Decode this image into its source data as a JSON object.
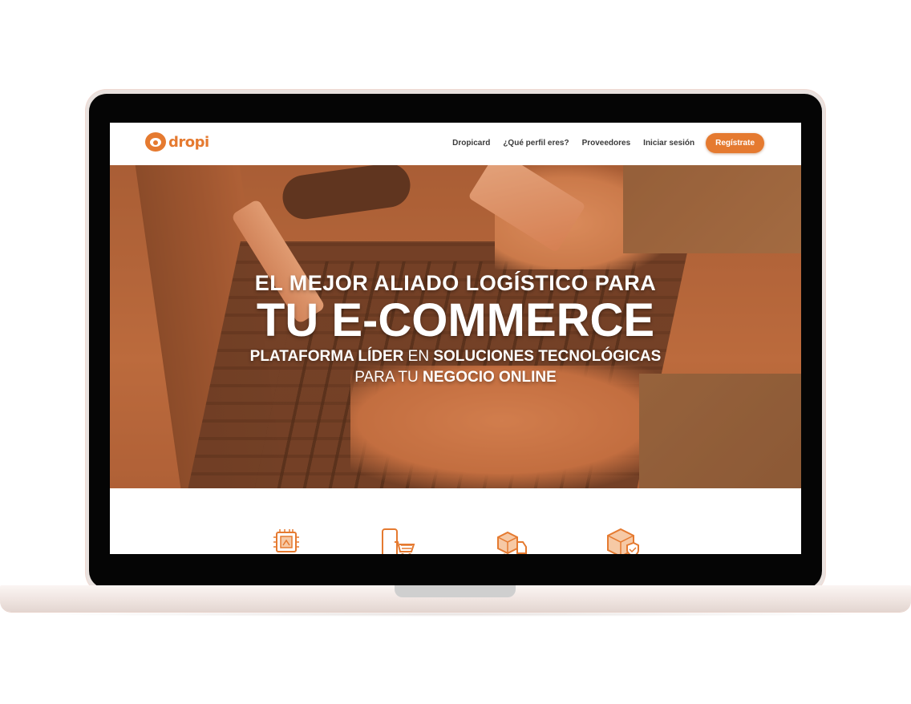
{
  "navbar": {
    "logo_text": "dropi",
    "links": [
      {
        "label": "Dropicard"
      },
      {
        "label": "¿Qué perfil eres?"
      },
      {
        "label": "Proveedores"
      },
      {
        "label": "Iniciar sesión"
      }
    ],
    "register_label": "Regístrate"
  },
  "hero": {
    "line1": "EL MEJOR ALIADO LOGÍSTICO PARA",
    "line2": "TU E-COMMERCE",
    "sub1_a": "PLATAFORMA LÍDER",
    "sub1_b": " EN ",
    "sub1_c": "SOLUCIONES TECNOLÓGICAS",
    "sub2_a": "PARA TU ",
    "sub2_b": "NEGOCIO ONLINE"
  },
  "features": {
    "icons": [
      "chip-icon",
      "mobile-cart-icon",
      "delivery-truck-icon",
      "secure-package-icon"
    ]
  },
  "colors": {
    "brand_orange": "#e57a30"
  }
}
